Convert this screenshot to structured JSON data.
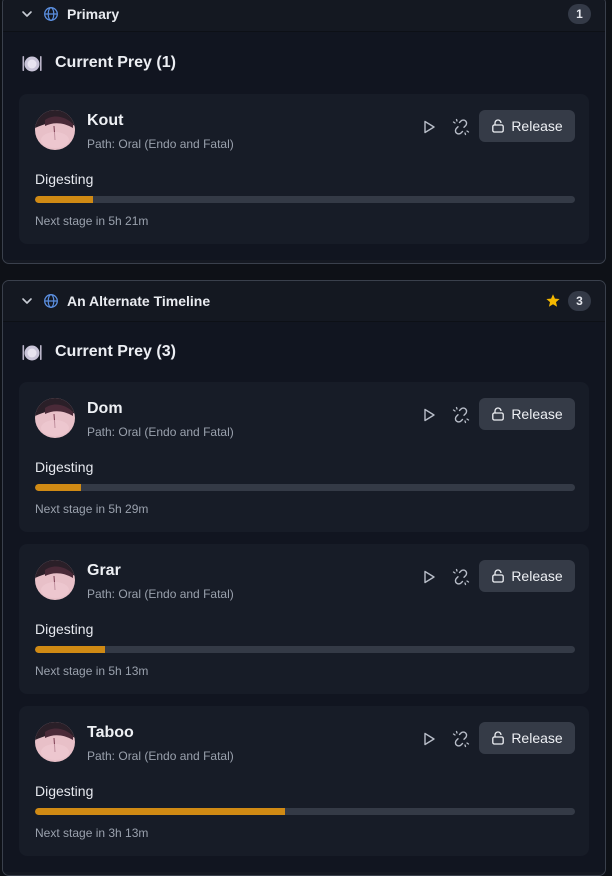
{
  "icons": {
    "chevron": "chevron-down-icon",
    "world": "globe-icon",
    "plate": "plate-utensils-icon",
    "play": "play-icon",
    "chain": "broken-link-icon",
    "lock": "unlock-icon",
    "star": "star-icon"
  },
  "colors": {
    "accent_progress": "#d08a14",
    "globe": "#5b8fe0",
    "star": "#f5b800",
    "button_bg": "#353b47"
  },
  "groups": [
    {
      "name": "Primary",
      "count": "1",
      "starred": false,
      "section_label": "Current Prey (1)",
      "prey": [
        {
          "name": "Kout",
          "path": "Path: Oral (Endo and Fatal)",
          "status": "Digesting",
          "progress": 0.107,
          "next": "Next stage in 5h 21m",
          "release_label": "Release"
        }
      ]
    },
    {
      "name": "An Alternate Timeline",
      "count": "3",
      "starred": true,
      "section_label": "Current Prey (3)",
      "prey": [
        {
          "name": "Dom",
          "path": "Path: Oral (Endo and Fatal)",
          "status": "Digesting",
          "progress": 0.085,
          "next": "Next stage in 5h 29m",
          "release_label": "Release"
        },
        {
          "name": "Grar",
          "path": "Path: Oral (Endo and Fatal)",
          "status": "Digesting",
          "progress": 0.13,
          "next": "Next stage in 5h 13m",
          "release_label": "Release"
        },
        {
          "name": "Taboo",
          "path": "Path: Oral (Endo and Fatal)",
          "status": "Digesting",
          "progress": 0.463,
          "next": "Next stage in 3h 13m",
          "release_label": "Release"
        }
      ]
    }
  ]
}
